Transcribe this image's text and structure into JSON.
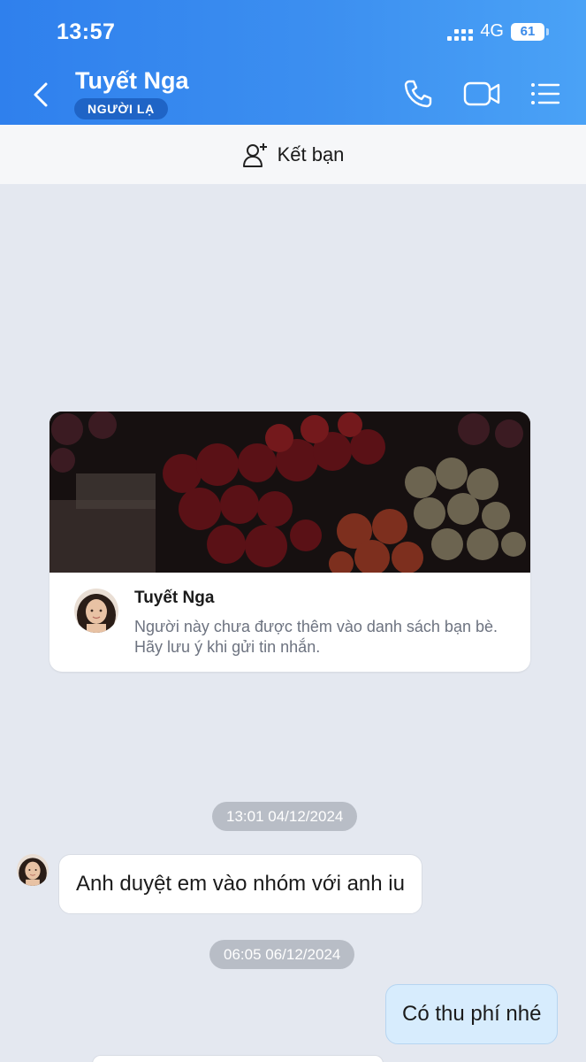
{
  "status_bar": {
    "time": "13:57",
    "network": "4G",
    "battery": "61"
  },
  "header": {
    "contact_name": "Tuyết Nga",
    "badge": "NGƯỜI LẠ",
    "icons": [
      "back-icon",
      "call-icon",
      "video-call-icon",
      "menu-icon"
    ]
  },
  "add_friend": {
    "label": "Kết bạn",
    "icon": "add-user-icon"
  },
  "profile_card": {
    "name": "Tuyết Nga",
    "note": "Người này chưa được thêm vào danh sách bạn bè. Hãy lưu ý khi gửi tin nhắn."
  },
  "messages": [
    {
      "timestamp": "13:01 04/12/2024",
      "direction": "incoming",
      "text": "Anh duyệt em vào nhóm với anh iu"
    },
    {
      "timestamp": "06:05 06/12/2024",
      "direction": "outgoing",
      "text": "Có thu phí nhé"
    }
  ],
  "colors": {
    "header": "#3c8ff0",
    "badge": "#1f64c6",
    "chat_bg": "#e4e8f0",
    "outgoing_bubble": "#d7ecfd"
  }
}
